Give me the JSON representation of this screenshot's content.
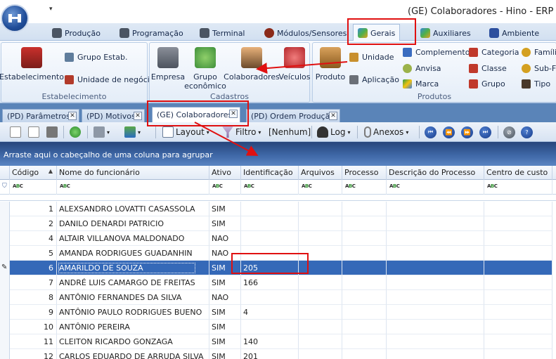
{
  "window": {
    "title": "(GE) Colaboradores - Hino - ERP"
  },
  "ribbon_tabs": [
    {
      "label": "Produção"
    },
    {
      "label": "Programação"
    },
    {
      "label": "Terminal"
    },
    {
      "label": "Módulos/Sensores"
    },
    {
      "label": "Gerais"
    },
    {
      "label": "Auxiliares"
    },
    {
      "label": "Ambiente"
    }
  ],
  "ribbon": {
    "estabelecimento": {
      "group_label": "Estabelecimento",
      "estabelecimento_btn": "Estabelecimento",
      "grupo_estab": "Grupo Estab.",
      "unidade_negocio": "Unidade de negócio"
    },
    "cadastros": {
      "group_label": "Cadastros",
      "empresa": "Empresa",
      "grupo_line1": "Grupo",
      "grupo_line2": "econômico",
      "colaboradores": "Colaboradores",
      "veiculos": "Veículos"
    },
    "produtos": {
      "group_label": "Produtos",
      "produto": "Produto",
      "unidade": "Unidade",
      "aplicacao": "Aplicação",
      "complemento": "Complemento",
      "anvisa": "Anvisa",
      "marca": "Marca",
      "categoria": "Categoria",
      "classe": "Classe",
      "grupo": "Grupo",
      "familia": "Famíli",
      "subfamilia": "Sub-Fa",
      "tipo": "Tipo"
    }
  },
  "doc_tabs": [
    {
      "label": "(PD) Parâmetros"
    },
    {
      "label": "(PD) Motivos"
    },
    {
      "label": "(GE) Colaboradores"
    },
    {
      "label": "(PD) Ordem Produção"
    }
  ],
  "toolbar": {
    "layout": "Layout",
    "filtro": "Filtro",
    "filter_value": "[Nenhum]",
    "log": "Log",
    "anexos": "Anexos"
  },
  "grid": {
    "group_hint": "Arraste aqui o cabeçalho de uma coluna para agrupar",
    "columns": [
      "Código",
      "Nome do funcionário",
      "Ativo",
      "Identificação",
      "Arquivos",
      "Processo",
      "Descrição do Processo",
      "Centro de custo"
    ],
    "rows": [
      {
        "code": "1",
        "name": "ALEXSANDRO LOVATTI CASASSOLA",
        "ativo": "SIM",
        "ident": ""
      },
      {
        "code": "2",
        "name": "DANILO DENARDI PATRICIO",
        "ativo": "SIM",
        "ident": ""
      },
      {
        "code": "4",
        "name": "ALTAIR VILLANOVA MALDONADO",
        "ativo": "NAO",
        "ident": ""
      },
      {
        "code": "5",
        "name": "AMANDA RODRIGUES GUADANHIN",
        "ativo": "NAO",
        "ident": ""
      },
      {
        "code": "6",
        "name": "AMARILDO DE SOUZA",
        "ativo": "SIM",
        "ident": "205"
      },
      {
        "code": "7",
        "name": "ANDRÉ LUIS CAMARGO DE FREITAS",
        "ativo": "SIM",
        "ident": "166"
      },
      {
        "code": "8",
        "name": "ANTÔNIO FERNANDES DA SILVA",
        "ativo": "NAO",
        "ident": ""
      },
      {
        "code": "9",
        "name": "ANTÔNIO PAULO RODRIGUES BUENO",
        "ativo": "SIM",
        "ident": "4"
      },
      {
        "code": "10",
        "name": "ANTÔNIO PEREIRA",
        "ativo": "SIM",
        "ident": ""
      },
      {
        "code": "11",
        "name": "CLEITON RICARDO GONZAGA",
        "ativo": "SIM",
        "ident": "140"
      },
      {
        "code": "12",
        "name": "CARLOS EDUARDO DE ARRUDA SILVA",
        "ativo": "SIM",
        "ident": "201"
      }
    ]
  },
  "colors": {
    "accent": "#3569b8",
    "highlight": "#e01010",
    "groupbar": "#3e67a6"
  }
}
